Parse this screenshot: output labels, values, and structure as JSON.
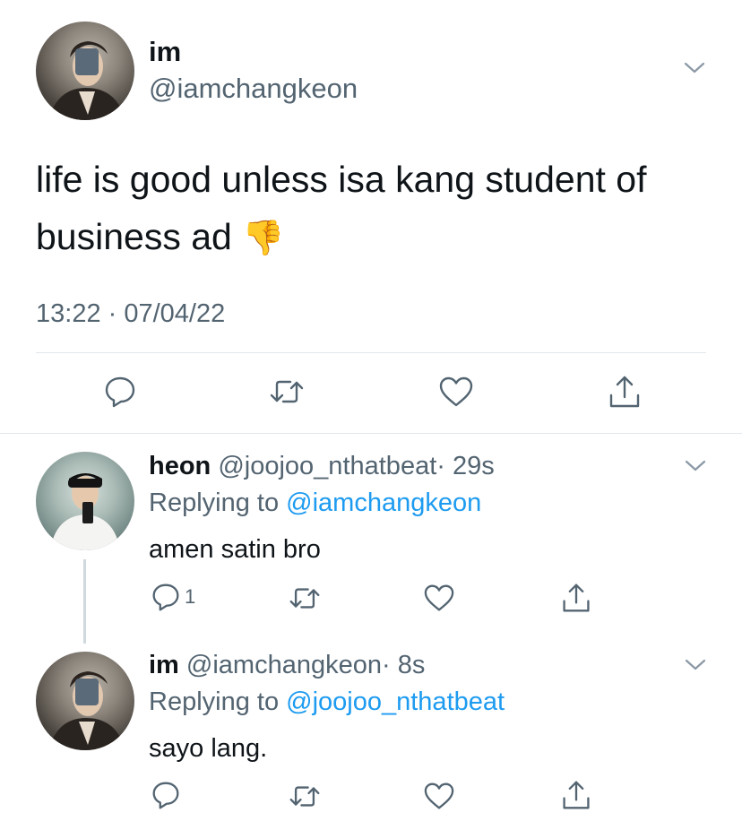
{
  "main_tweet": {
    "display_name": "im",
    "handle": "@iamchangkeon",
    "text": "life is good unless isa kang student of business ad",
    "emoji": "👎",
    "timestamp": "13:22 · 07/04/22"
  },
  "replies": [
    {
      "display_name": "heon",
      "handle": "@joojoo_nthatbeat",
      "time": "· 29s",
      "replying_label": "Replying to",
      "replying_handle": "@iamchangkeon",
      "text": "amen satin bro",
      "reply_count": "1"
    },
    {
      "display_name": "im",
      "handle": "@iamchangkeon",
      "time": "· 8s",
      "replying_label": "Replying to",
      "replying_handle": "@joojoo_nthatbeat",
      "text": "sayo lang.",
      "reply_count": ""
    }
  ],
  "icons": {
    "reply": "reply-icon",
    "retweet": "retweet-icon",
    "like": "heart-icon",
    "share": "share-icon",
    "more": "chevron-down-icon"
  },
  "colors": {
    "link_blue": "#1d9bf0",
    "secondary_text": "#536471",
    "divider": "#e1e8ed"
  }
}
